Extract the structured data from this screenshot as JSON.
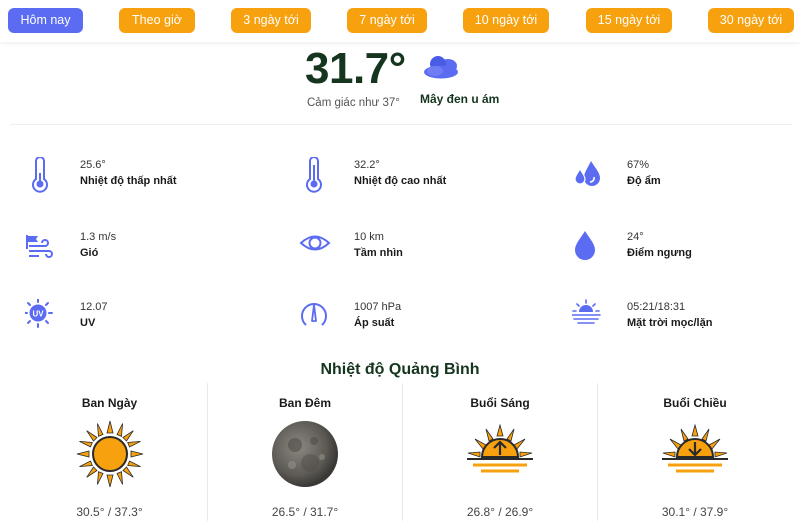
{
  "tabs": [
    {
      "label": "Hôm nay",
      "active": true
    },
    {
      "label": "Theo giờ",
      "active": false
    },
    {
      "label": "3 ngày tới",
      "active": false
    },
    {
      "label": "7 ngày tới",
      "active": false
    },
    {
      "label": "10 ngày tới",
      "active": false
    },
    {
      "label": "15 ngày tới",
      "active": false
    },
    {
      "label": "30 ngày tới",
      "active": false
    }
  ],
  "current": {
    "temperature": "31.7°",
    "feels_like": "Cảm giác như 37°",
    "condition": "Mây đen u ám",
    "condition_icon": "cloud-icon"
  },
  "stats": [
    {
      "value": "25.6°",
      "label": "Nhiệt độ thấp nhất",
      "icon": "thermometer-low-icon"
    },
    {
      "value": "32.2°",
      "label": "Nhiệt độ cao nhất",
      "icon": "thermometer-high-icon"
    },
    {
      "value": "67%",
      "label": "Độ ẩm",
      "icon": "humidity-icon"
    },
    {
      "value": "1.3 m/s",
      "label": "Gió",
      "icon": "wind-icon"
    },
    {
      "value": "10 km",
      "label": "Tầm nhìn",
      "icon": "eye-icon"
    },
    {
      "value": "24°",
      "label": "Điểm ngưng",
      "icon": "dew-point-icon"
    },
    {
      "value": "12.07",
      "label": "UV",
      "icon": "uv-icon"
    },
    {
      "value": "1007 hPa",
      "label": "Áp suất",
      "icon": "pressure-gauge-icon"
    },
    {
      "value": "05:21/18:31",
      "label": "Mặt trời mọc/lặn",
      "icon": "sunrise-sunset-icon"
    }
  ],
  "section_title": "Nhiệt độ Quảng Bình",
  "periods": [
    {
      "name": "Ban Ngày",
      "range": "30.5° / 37.3°",
      "icon": "sun-icon"
    },
    {
      "name": "Ban Đêm",
      "range": "26.5° / 31.7°",
      "icon": "moon-icon"
    },
    {
      "name": "Buổi Sáng",
      "range": "26.8° / 26.9°",
      "icon": "sunrise-icon"
    },
    {
      "name": "Buổi Chiều",
      "range": "30.1° / 37.9°",
      "icon": "sunset-icon"
    }
  ],
  "colors": {
    "tab_active": "#5b6cf2",
    "tab_inactive": "#f7a10f",
    "icon_blue": "#5b6cf2",
    "sun_orange": "#f7a10f",
    "title_dark_green": "#15351e"
  }
}
